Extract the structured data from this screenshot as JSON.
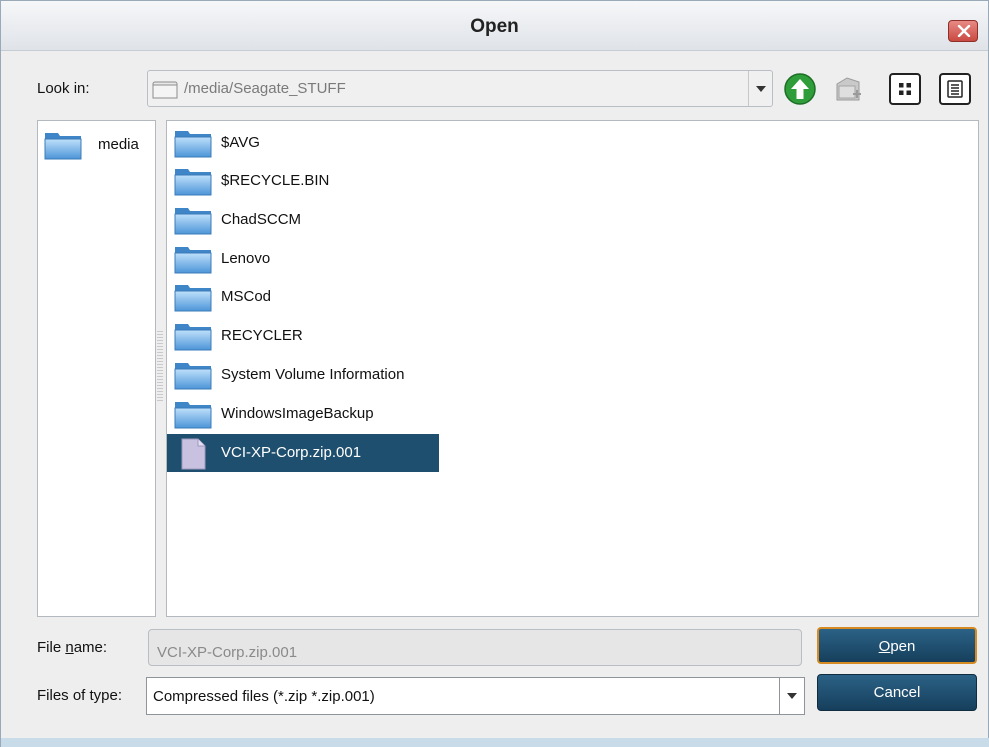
{
  "window": {
    "title": "Open"
  },
  "look_in": {
    "label": "Look in:",
    "path": "/media/Seagate_STUFF"
  },
  "toolbar": {
    "up_icon": "arrow-up-icon",
    "new_folder_icon": "new-folder-icon",
    "icon_view_icon": "icon-view-icon",
    "list_view_icon": "list-view-icon"
  },
  "places": [
    {
      "label": "media"
    }
  ],
  "files": [
    {
      "label": "$AVG",
      "type": "folder"
    },
    {
      "label": "$RECYCLE.BIN",
      "type": "folder"
    },
    {
      "label": "ChadSCCM",
      "type": "folder"
    },
    {
      "label": "Lenovo",
      "type": "folder"
    },
    {
      "label": "MSCod",
      "type": "folder"
    },
    {
      "label": "RECYCLER",
      "type": "folder"
    },
    {
      "label": "System Volume Information",
      "type": "folder"
    },
    {
      "label": "WindowsImageBackup",
      "type": "folder"
    },
    {
      "label": "VCI-XP-Corp.zip.001",
      "type": "file",
      "selected": true
    }
  ],
  "file_name": {
    "label_pre": "File ",
    "label_mnemonic": "n",
    "label_post": "ame:",
    "value": "VCI-XP-Corp.zip.001"
  },
  "file_type": {
    "label": "Files of type:",
    "value": "Compressed files (*.zip *.zip.001)"
  },
  "buttons": {
    "open_mnemonic": "O",
    "open_rest": "pen",
    "cancel": "Cancel"
  },
  "colors": {
    "selection": "#1f4f6e",
    "button": "#1f5070",
    "focus_border": "#d68a22"
  }
}
